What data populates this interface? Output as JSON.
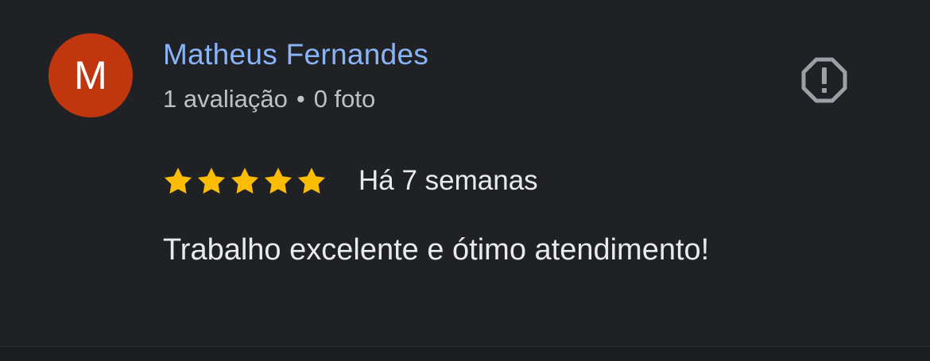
{
  "review": {
    "avatar_initial": "M",
    "author_name": "Matheus Fernandes",
    "reviews_count": "1 avaliação",
    "meta_separator": "•",
    "photos_count": "0 foto",
    "rating": 5,
    "rating_max": 5,
    "date": "Há 7 semanas",
    "text": "Trabalho excelente e ótimo atendimento!",
    "report_icon": "report-icon"
  },
  "colors": {
    "background": "#202124",
    "avatar": "#c0360f",
    "author_name": "#8ab4f8",
    "star": "#fbbc04",
    "text": "#e8eaed",
    "meta_text": "#bdc1c6",
    "icon": "#9aa0a6"
  }
}
